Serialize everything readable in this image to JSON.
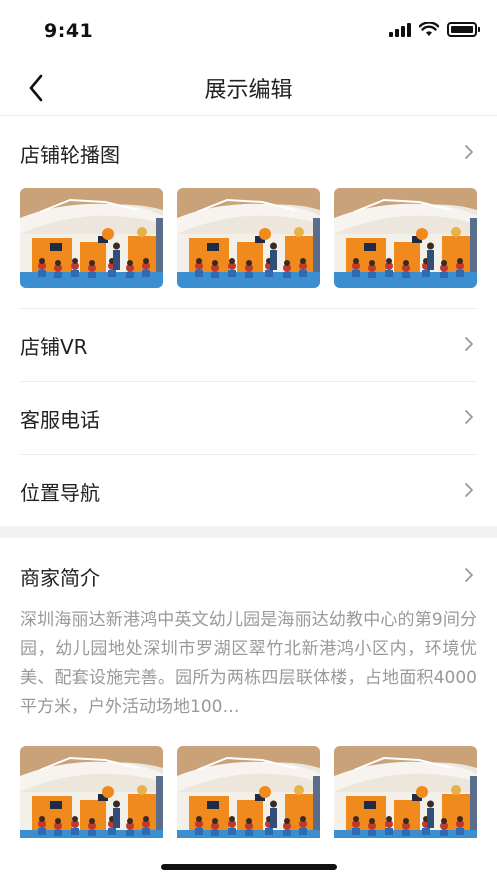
{
  "status_bar": {
    "time": "9:41",
    "battery_level": 1.0
  },
  "nav": {
    "title": "展示编辑",
    "back_icon": "chevron-left-icon"
  },
  "store_carousel": {
    "label": "店铺轮播图",
    "image_count": 3
  },
  "store_vr": {
    "label": "店铺VR"
  },
  "service_phone": {
    "label": "客服电话"
  },
  "location_nav": {
    "label": "位置导航"
  },
  "merchant_intro": {
    "label": "商家简介",
    "text": "深圳海丽达新港鸿中英文幼儿园是海丽达幼教中心的第9间分园，幼儿园地处深圳市罗湖区翠竹北新港鸿小区内，环境优美、配套设施完善。园所为两栋四层联体楼，占地面积4000平方米，户外活动场地100…",
    "image_count": 3
  },
  "colors": {
    "accent_orange": "#f08a1c",
    "divider": "#ececec",
    "muted_text": "#999999"
  }
}
